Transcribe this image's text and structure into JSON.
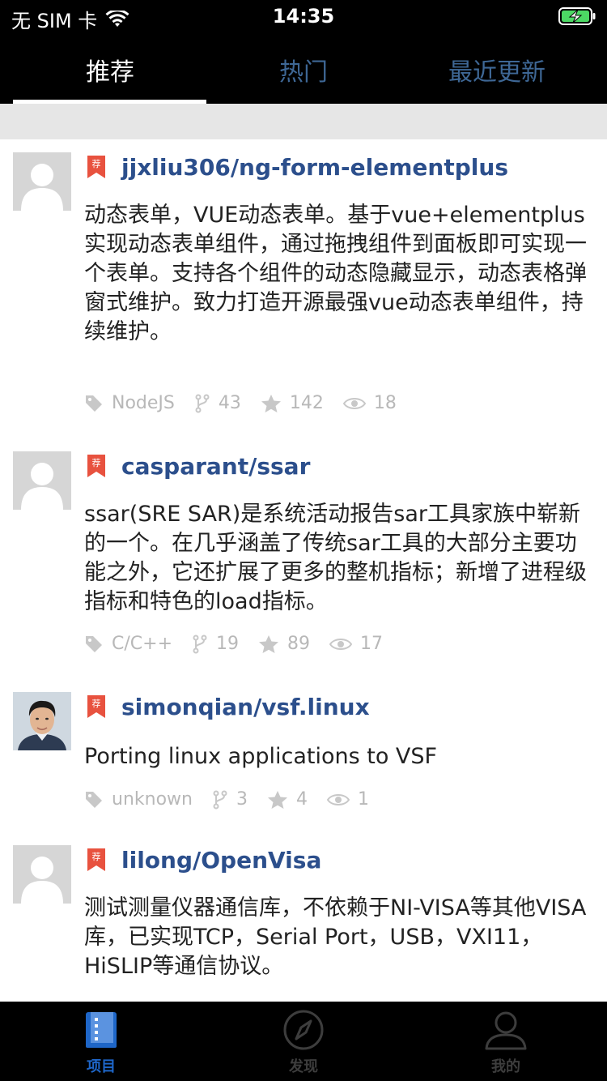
{
  "status": {
    "carrier": "无 SIM 卡",
    "time": "14:35"
  },
  "top_tabs": [
    "推荐",
    "热门",
    "最近更新"
  ],
  "active_tab": 0,
  "badge_text": "荐",
  "projects": [
    {
      "name": "jjxliu306/ng-form-elementplus",
      "description": "动态表单，VUE动态表单。基于vue+elementplus实现动态表单组件，通过拖拽组件到面板即可实现一个表单。支持各个组件的动态隐藏显示，动态表格弹窗式维护。致力打造开源最强vue动态表单组件，持续维护。",
      "language": "NodeJS",
      "forks": "43",
      "stars": "142",
      "watchers": "18",
      "avatar": "placeholder"
    },
    {
      "name": "casparant/ssar",
      "description": "ssar(SRE SAR)是系统活动报告sar工具家族中崭新的一个。在几乎涵盖了传统sar工具的大部分主要功能之外，它还扩展了更多的整机指标；新增了进程级指标和特色的load指标。",
      "language": "C/C++",
      "forks": "19",
      "stars": "89",
      "watchers": "17",
      "avatar": "placeholder"
    },
    {
      "name": "simonqian/vsf.linux",
      "description": "Porting linux applications to VSF",
      "language": "unknown",
      "forks": "3",
      "stars": "4",
      "watchers": "1",
      "avatar": "photo"
    },
    {
      "name": "lilong/OpenVisa",
      "description": "测试测量仪器通信库，不依赖于NI-VISA等其他VISA库，已实现TCP，Serial Port，USB，VXI11，HiSLIP等通信协议。",
      "avatar": "placeholder"
    }
  ],
  "bottom_tabs": [
    "项目",
    "发现",
    "我的"
  ],
  "colors": {
    "accent": "#1e66c8",
    "title": "#2c4f8c",
    "badge": "#e8523f",
    "meta": "#b8b8b8"
  }
}
